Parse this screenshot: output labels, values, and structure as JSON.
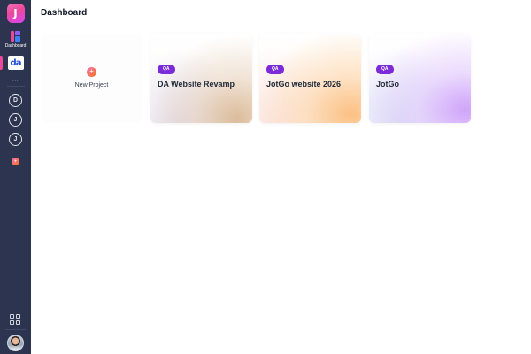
{
  "app": {
    "logo_letter": "J",
    "brand_gradient": [
      "#f472b6",
      "#d946ef"
    ],
    "sidebar_bg": "#2c344f"
  },
  "sidebar": {
    "dashboard_label": "Dashboard",
    "workspace_badge": "da",
    "dots": "...",
    "project_icons": [
      {
        "letter": "D",
        "icon": "project-d-icon"
      },
      {
        "letter": "J",
        "icon": "project-j-icon"
      },
      {
        "letter": "J",
        "icon": "project-j-icon"
      }
    ],
    "add_symbol": "+",
    "grid_icon": "apps-grid-icon",
    "avatar_icon": "user-avatar"
  },
  "header": {
    "title": "Dashboard"
  },
  "cards": {
    "new_project": {
      "label": "New Project",
      "symbol": "+"
    },
    "projects": [
      {
        "badge": "QA",
        "name": "DA Website Revamp",
        "accent": "#d6b28c"
      },
      {
        "badge": "QA",
        "name": "JotGo website 2026",
        "accent": "#fcba78"
      },
      {
        "badge": "QA",
        "name": "JotGo",
        "accent": "#cda0fa"
      }
    ],
    "badge_color": "#7c2bd9"
  }
}
